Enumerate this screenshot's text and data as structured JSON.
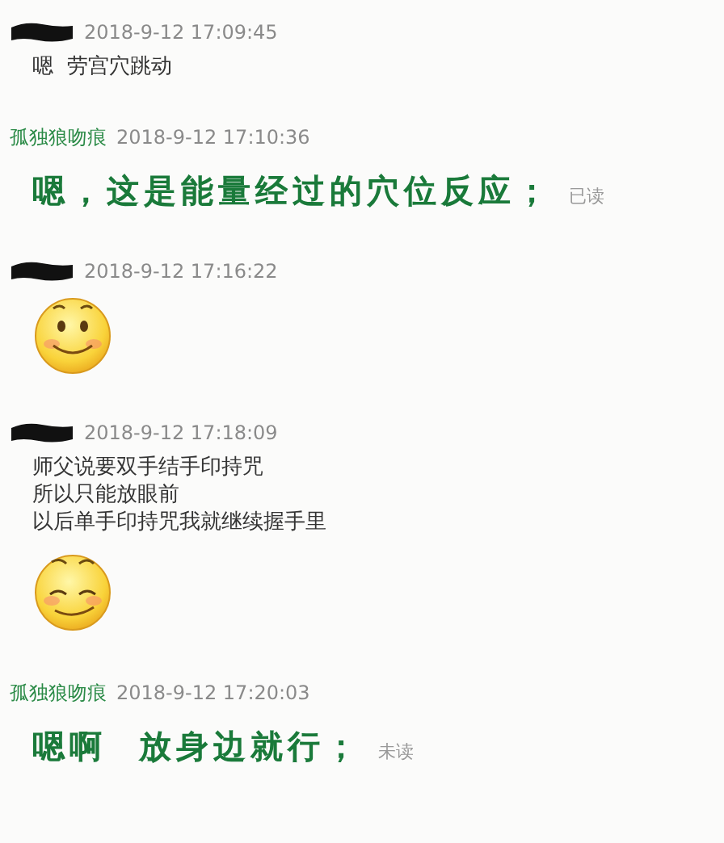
{
  "messages": [
    {
      "sender": {
        "kind": "redacted"
      },
      "time": "2018-9-12 17:09:45",
      "body": {
        "kind": "text",
        "lines": [
          "嗯  劳宫穴跳动"
        ]
      }
    },
    {
      "sender": {
        "kind": "named",
        "name": "孤独狼吻痕"
      },
      "time": "2018-9-12 17:10:36",
      "body": {
        "kind": "big",
        "lines": [
          "嗯，这是能量经过的穴位反应；"
        ]
      },
      "status": "已读"
    },
    {
      "sender": {
        "kind": "redacted"
      },
      "time": "2018-9-12 17:16:22",
      "body": {
        "kind": "emoji",
        "emoji": {
          "kind": "smile"
        }
      }
    },
    {
      "sender": {
        "kind": "redacted"
      },
      "time": "2018-9-12 17:18:09",
      "body": {
        "kind": "text",
        "lines": [
          "师父说要双手结手印持咒",
          "所以只能放眼前",
          "以后单手印持咒我就继续握手里"
        ],
        "emoji": {
          "kind": "content"
        }
      }
    },
    {
      "sender": {
        "kind": "named",
        "name": "孤独狼吻痕"
      },
      "time": "2018-9-12 17:20:03",
      "body": {
        "kind": "big",
        "lines": [
          "嗯啊  放身边就行；"
        ]
      },
      "status": "未读"
    }
  ]
}
